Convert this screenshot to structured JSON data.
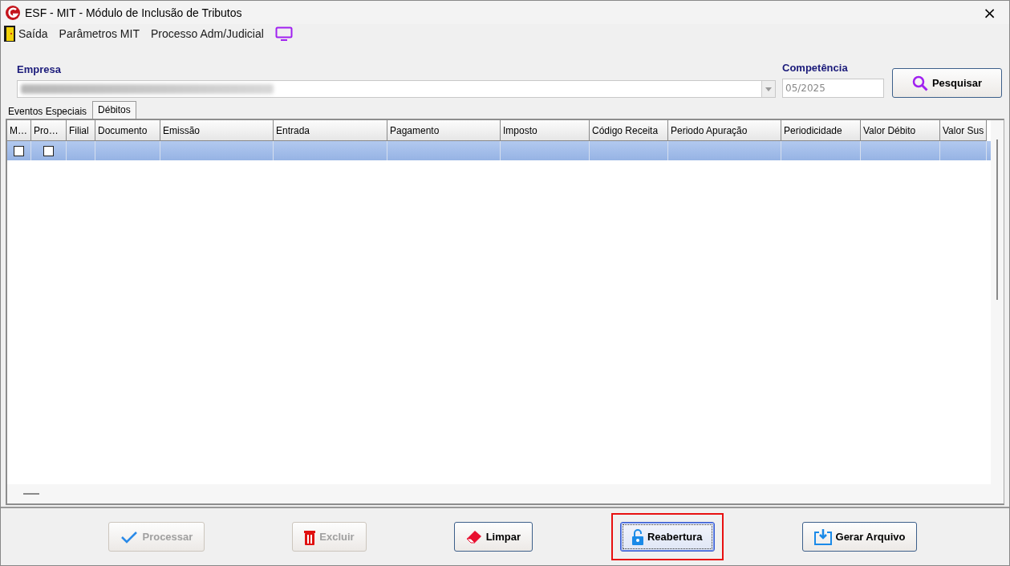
{
  "window": {
    "title": "ESF - MIT - Módulo de Inclusão de Tributos",
    "close": "×"
  },
  "menu": [
    {
      "label": "Saída",
      "kind": "exit"
    },
    {
      "label": "Parâmetros MIT",
      "kind": "plain"
    },
    {
      "label": "Processo Adm/Judicial",
      "kind": "plain"
    },
    {
      "kind": "monitor"
    }
  ],
  "empresa": {
    "label": "Empresa",
    "blurred": true
  },
  "competencia": {
    "label": "Competência",
    "value": "05/2025"
  },
  "search_button": {
    "label": "Pesquisar"
  },
  "tabs": [
    {
      "label": "Eventos Especiais",
      "selected": false
    },
    {
      "label": "Débitos",
      "selected": true
    }
  ],
  "table": {
    "columns": [
      "M…",
      "Pro…",
      "Filial",
      "Documento",
      "Emissão",
      "Entrada",
      "Pagamento",
      "Imposto",
      "Código Receita",
      "Periodo Apuração",
      "Periodicidade",
      "Valor Débito",
      "Valor Sus"
    ],
    "rows": [
      {
        "selected": true,
        "checks": [
          false,
          false
        ]
      }
    ]
  },
  "buttons": [
    {
      "label": "Processar",
      "kind": "check",
      "disabled": true,
      "focused": false,
      "highlighted": false
    },
    {
      "label": "Excluir",
      "kind": "trash",
      "disabled": true,
      "focused": false,
      "highlighted": false
    },
    {
      "label": "Limpar",
      "kind": "eraser",
      "disabled": false,
      "focused": false,
      "highlighted": false
    },
    {
      "label": "Reabertura",
      "kind": "unlock",
      "disabled": false,
      "focused": true,
      "highlighted": true
    },
    {
      "label": "Gerar Arquivo",
      "kind": "download",
      "disabled": false,
      "focused": false,
      "highlighted": false
    }
  ]
}
